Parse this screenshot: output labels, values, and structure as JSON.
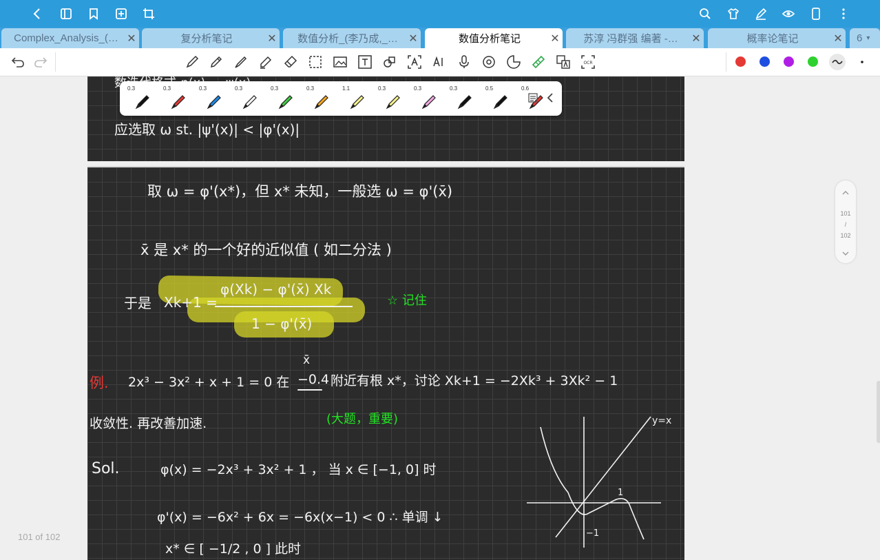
{
  "tabs": [
    {
      "label": "Complex_Analysis_(…"
    },
    {
      "label": "复分析笔记"
    },
    {
      "label": "数值分析_(李乃成,_…"
    },
    {
      "label": "数值分析笔记"
    },
    {
      "label": "苏淳 冯群强 编著 -…"
    },
    {
      "label": "概率论笔记"
    }
  ],
  "tab_overflow_count": "6",
  "pen_palette": {
    "sizes": [
      "0.3",
      "0.3",
      "0.3",
      "0.3",
      "0.3",
      "0.3",
      "1.1",
      "0.3",
      "0.3",
      "0.3",
      "0.5",
      "0.6"
    ],
    "colors": [
      "#111111",
      "#e53935",
      "#1e88e5",
      "#ffffff",
      "#43c943",
      "#f5a623",
      "#f7f28a",
      "#f7f28a",
      "#f0a8e0",
      "#111111",
      "#111111",
      "#e53935"
    ]
  },
  "color_dots": [
    "#e53935",
    "#1e4fe0",
    "#b01ee6",
    "#2ed12e"
  ],
  "pager": {
    "current": "101",
    "sep": "/",
    "total": "102"
  },
  "page_label": "101 of 102",
  "note": {
    "top_line1": "数迭代格式  φ(x)  …  ψ(x)",
    "top_line2": "应选取 ω  st.  |ψ'(x)|  <  |φ'(x)|",
    "line1": "取 ω = φ'(x*)，但 x* 未知，一般选  ω = φ'(x̄)",
    "line2": "x̄ 是 x* 的一个好的近似值 ( 如二分法 )",
    "yu_shi": "于是",
    "x_k1": "Xk+1  =",
    "numerator": "φ(Xk) − φ'(x̄) Xk",
    "denominator": "1 −  φ'(x̄)",
    "remember": "☆ 记住",
    "li": "例.",
    "ex_eq": "2x³ − 3x² + x + 1 = 0  在",
    "xbar": "x̄",
    "neg04": "−0.4",
    "ex_rest": "附近有根 x*，讨论  Xk+1 = −2Xk³ + 3Xk² − 1",
    "converge": "收敛性.  再改善加速.",
    "important": "(大题，重要)",
    "sol": "Sol.",
    "sol_eq": "φ(x) = −2x³ + 3x² + 1 ，  当 x ∈ [−1, 0] 时",
    "deriv": "φ'(x) =  −6x² + 6x =  −6x(x−1) < 0   ∴ 单调 ↓",
    "last": "x* ∈ [ −1/2 , 0 ]  此时",
    "graph_yx": "y=x",
    "graph_1": "1",
    "graph_m1": "−1"
  }
}
